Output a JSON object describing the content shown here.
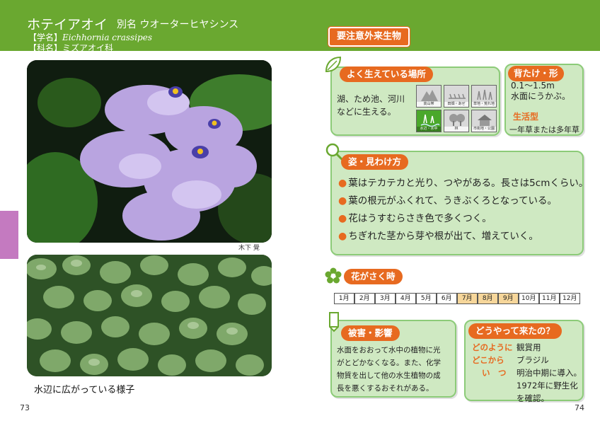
{
  "header": {
    "title": "ホテイアオイ",
    "alt_name": "別名 ウオーターヒヤシンス",
    "scientific_label": "【学名】",
    "scientific_name": "Eichhornia crassipes",
    "family_label": "【科名】",
    "family_name": "ミズアオイ科"
  },
  "photos": {
    "credit": "木下 覺",
    "caption": "水辺に広がっている様子"
  },
  "pages": {
    "left": "73",
    "right": "74"
  },
  "badge": "要注意外来生物",
  "habitat": {
    "label": "よく生えている場所",
    "text_1": "湖、ため池、河川",
    "text_2": "などに生える。",
    "cells": [
      {
        "label": "高山帯",
        "on": false
      },
      {
        "label": "田畑・あぜ",
        "on": false
      },
      {
        "label": "草地・荒れ地",
        "on": false
      },
      {
        "label": "水辺・水中",
        "on": true
      },
      {
        "label": "林",
        "on": false
      },
      {
        "label": "市街地・公園",
        "on": false
      }
    ]
  },
  "height": {
    "label": "背たけ・形",
    "text_1": "0.1～1.5m",
    "text_2": "水面にうかぶ。",
    "life_label": "生活型",
    "life_text": "一年草または多年草"
  },
  "features": {
    "label": "姿・見わけ方",
    "items": [
      "葉はテカテカと光り、つやがある。長さは5cmくらい。",
      "葉の根元がふくれて、うきぶくろとなっている。",
      "花はうすむらさき色で多くつく。",
      "ちぎれた茎から芽や根が出て、増えていく。"
    ]
  },
  "flowering": {
    "label": "花がさく時",
    "months": [
      "1月",
      "2月",
      "3月",
      "4月",
      "5月",
      "6月",
      "7月",
      "8月",
      "9月",
      "10月",
      "11月",
      "12月"
    ],
    "bloom_months": [
      7,
      8,
      9
    ]
  },
  "damage": {
    "label": "被害・影響",
    "lines": [
      "水面をおおって水中の植物に光",
      "がとどかなくなる。また、化学",
      "物質を出して他の水生植物の成",
      "長を悪くするおそれがある。"
    ]
  },
  "origin": {
    "label": "どうやって来たの？",
    "purpose_label": "どのように",
    "purpose": "観賞用",
    "from_label": "どこから",
    "from": "ブラジル",
    "when_label": "い　つ",
    "when": "明治中期に導入。",
    "when_2": "1972年に野生化",
    "when_3": "を確認。"
  },
  "colors": {
    "header": "#6aa830",
    "accent": "#e76a20",
    "card": "#cfe9c2",
    "bloom": "#f6d69a",
    "side_tab": "#c47ac0"
  }
}
